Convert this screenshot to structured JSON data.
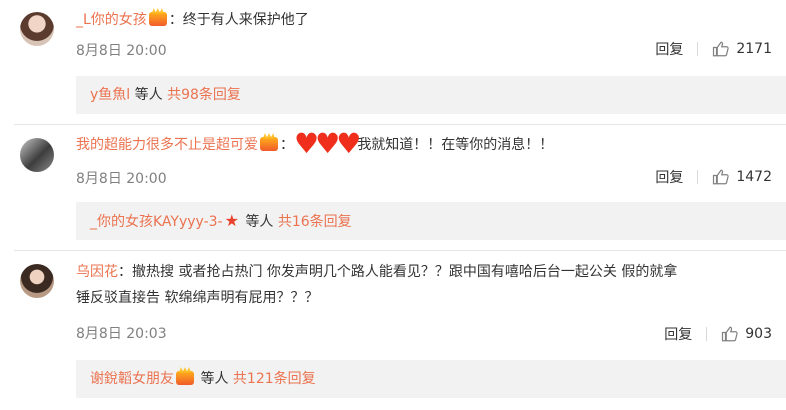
{
  "comments": [
    {
      "username": "_L你的女孩",
      "text": "：终于有人来保护他了",
      "time": "8月8日 20:00",
      "reply_label": "回复",
      "likes": "2171",
      "thread": {
        "user": "y鱼魚l",
        "mid": "等人",
        "count": "共98条回复"
      }
    },
    {
      "username": "我的超能力很多不止是超可爱",
      "colon": "：",
      "text": "我就知道！！在等你的消息！！",
      "time": "8月8日 20:00",
      "reply_label": "回复",
      "likes": "1472",
      "thread": {
        "user": "_你的女孩KAYyyy-3-",
        "mid": "等人",
        "count": "共16条回复"
      }
    },
    {
      "username": "乌因花",
      "text_line1": "：撤热搜 或者抢占热门 你发声明几个路人能看见？？跟中国有嘻哈后台一起公关 假的就拿",
      "text_line2": "锤反驳直接告 软绵绵声明有屁用？？？",
      "time": "8月8日 20:03",
      "reply_label": "回复",
      "likes": "903",
      "thread": {
        "user": "谢銳韜女朋友",
        "mid": "等人",
        "count": "共121条回复"
      }
    }
  ],
  "colors": {
    "accent": "#eb7350",
    "muted": "#808080",
    "thread_bg": "#f2f2f2"
  },
  "icons": {
    "like": "thumbs-up-icon",
    "vip": "crown-badge-icon",
    "star": "star-icon",
    "heart": "heart-emoji"
  }
}
